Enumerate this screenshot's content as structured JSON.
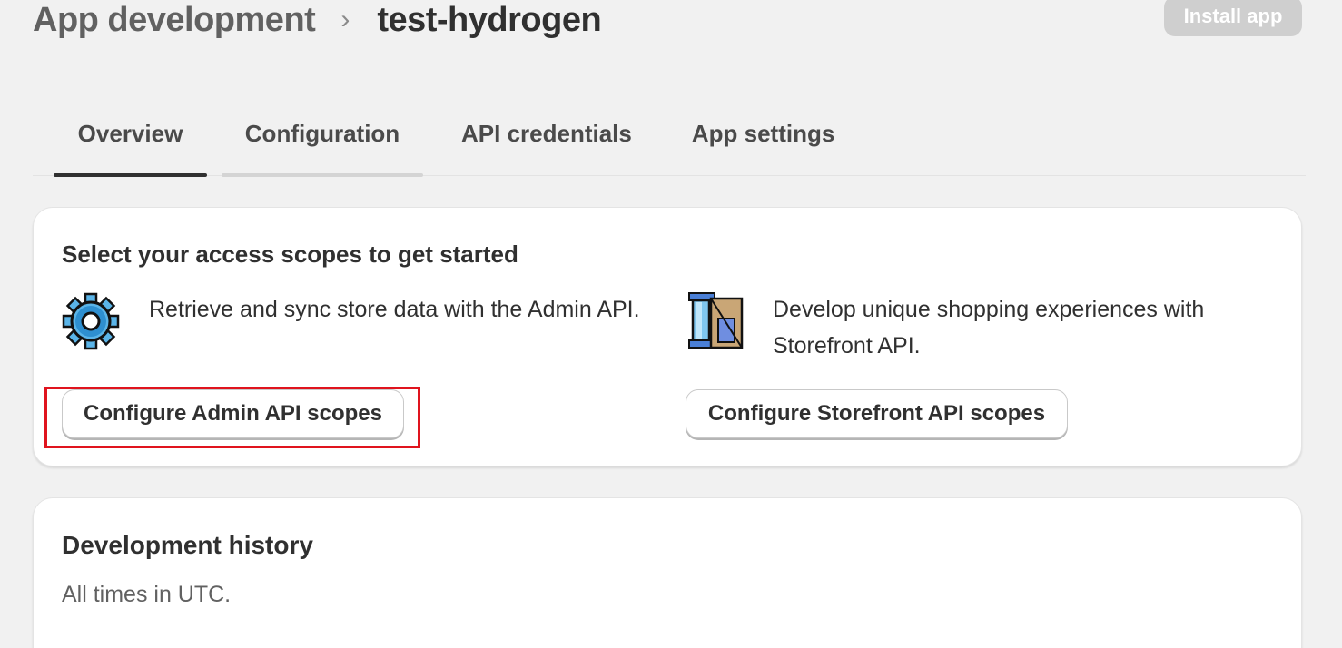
{
  "header": {
    "breadcrumb_parent": "App development",
    "breadcrumb_separator": "›",
    "breadcrumb_current": "test-hydrogen",
    "install_label": "Install app"
  },
  "tabs": [
    {
      "label": "Overview",
      "active": true
    },
    {
      "label": "Configuration",
      "active": false
    },
    {
      "label": "API credentials",
      "active": false
    },
    {
      "label": "App settings",
      "active": false
    }
  ],
  "scopes_card": {
    "title": "Select your access scopes to get started",
    "admin": {
      "icon": "gear-icon",
      "description": "Retrieve and sync store data with the Admin API.",
      "button_label": "Configure Admin API scopes"
    },
    "storefront": {
      "icon": "storefront-tools-icon",
      "description": "Develop unique shopping experiences with Storefront API.",
      "button_label": "Configure Storefront API scopes"
    }
  },
  "history_card": {
    "title": "Development history",
    "subtitle": "All times in UTC."
  },
  "colors": {
    "background": "#f1f1f1",
    "highlight": "#e0141e",
    "active_tab_underline": "#303030"
  }
}
